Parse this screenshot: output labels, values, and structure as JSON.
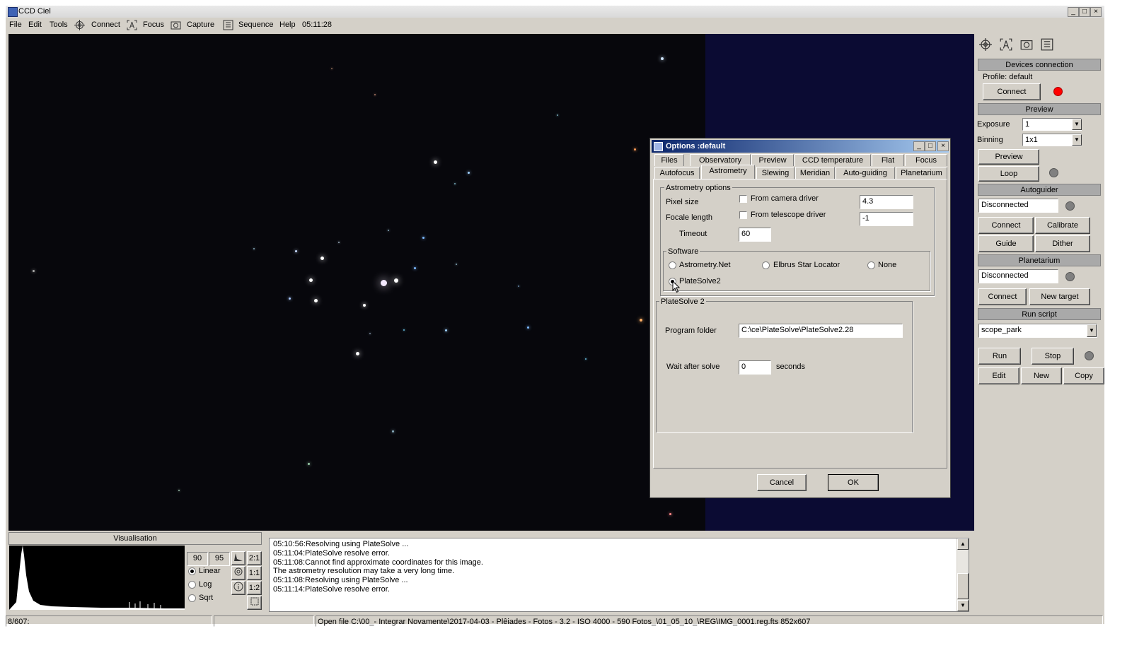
{
  "window": {
    "title": "CCD Ciel",
    "min": "_",
    "max": "□",
    "close": "×"
  },
  "menu": {
    "file": "File",
    "edit": "Edit",
    "tools": "Tools",
    "connect": "Connect",
    "focus": "Focus",
    "capture": "Capture",
    "sequence": "Sequence",
    "help": "Help",
    "time": "05:11:28"
  },
  "right_panel": {
    "devices": {
      "title": "Devices connection",
      "profile": "Profile: default",
      "connect": "Connect",
      "status_color": "#ff0000"
    },
    "preview": {
      "title": "Preview",
      "exposure_label": "Exposure",
      "exposure_value": "1",
      "binning_label": "Binning",
      "binning_value": "1x1",
      "preview_button": "Preview",
      "loop_button": "Loop"
    },
    "autoguider": {
      "title": "Autoguider",
      "status": "Disconnected",
      "connect": "Connect",
      "calibrate": "Calibrate",
      "guide": "Guide",
      "dither": "Dither"
    },
    "planetarium": {
      "title": "Planetarium",
      "status": "Disconnected",
      "connect": "Connect",
      "new_target": "New target"
    },
    "run_script": {
      "title": "Run script",
      "script": "scope_park",
      "run": "Run",
      "stop": "Stop",
      "edit": "Edit",
      "new": "New",
      "copy": "Copy"
    }
  },
  "dialog": {
    "title": "Options :default",
    "tabs_row1": [
      "Files",
      "Observatory",
      "Preview",
      "CCD temperature",
      "Flat",
      "Focus"
    ],
    "tabs_row2": [
      "Autofocus",
      "Astrometry",
      "Slewing",
      "Meridian",
      "Auto-guiding",
      "Planetarium"
    ],
    "active_tab": "Astrometry",
    "astrometry_options": {
      "title": "Astrometry options",
      "pixel_size_label": "Pixel size",
      "from_camera_driver": "From camera driver",
      "pixel_size_value": "4.3",
      "focale_length_label": "Focale length",
      "from_telescope_driver": "From telescope driver",
      "focale_length_value": "-1",
      "timeout_label": "Timeout",
      "timeout_value": "60"
    },
    "software": {
      "title": "Software",
      "astrometry_net": "Astrometry.Net",
      "elbrus": "Elbrus Star Locator",
      "none": "None",
      "platesolve2": "PlateSolve2",
      "selected": "PlateSolve2"
    },
    "platesolve2": {
      "title": "PlateSolve 2",
      "program_folder_label": "Program folder",
      "program_folder_value": "C:\\ce\\PlateSolve\\PlateSolve2.28",
      "wait_label": "Wait after solve",
      "wait_value": "0",
      "seconds": "seconds"
    },
    "cancel": "Cancel",
    "ok": "OK"
  },
  "visualisation": {
    "title": "Visualisation",
    "low": "90",
    "high": "95",
    "linear": "Linear",
    "log": "Log",
    "sqrt": "Sqrt",
    "zoom_2_1": "2:1",
    "zoom_1_1": "1:1",
    "zoom_1_2": "1:2"
  },
  "log": [
    "05:10:56:Resolving using PlateSolve ...",
    "05:11:04:PlateSolve resolve error.",
    "05:11:08:Cannot find approximate coordinates for this image.",
    "The astrometry resolution may take a very long time.",
    "05:11:08:Resolving using PlateSolve ...",
    "05:11:14:PlateSolve resolve error."
  ],
  "statusbar": {
    "left": "8/607:",
    "middle": "",
    "file": "Open file C:\\00_- Integrar Novamente\\2017-04-03 - Plêiades - Fotos - 3.2 - ISO 4000 - 590 Fotos_\\01_05_10_\\REG\\IMG_0001.reg.fts 852x607"
  }
}
